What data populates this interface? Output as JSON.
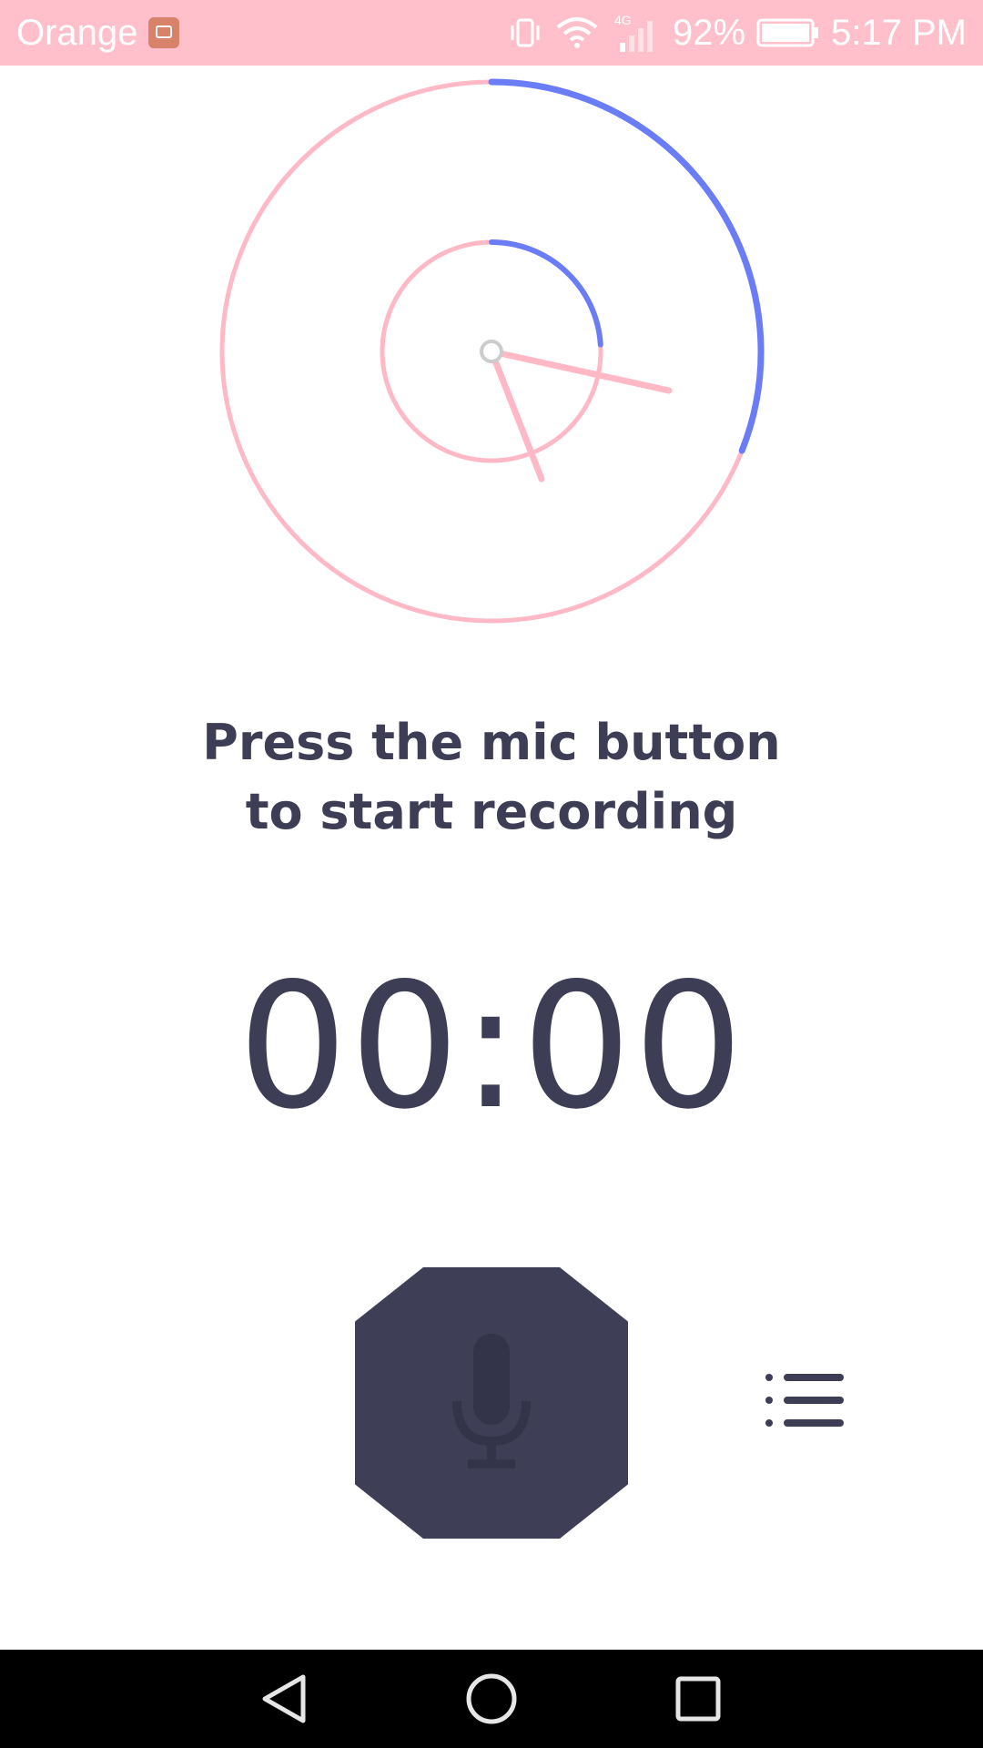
{
  "status_bar": {
    "carrier": "Orange",
    "network": "4G",
    "battery": "92%",
    "time": "5:17 PM",
    "icons": [
      "notification-icon",
      "vibrate-icon",
      "wifi-icon",
      "signal-icon",
      "battery-icon"
    ]
  },
  "clock": {
    "outer_progress_fraction": 0.31,
    "inner_progress_fraction": 0.24,
    "colors": {
      "track": "#ffb8c6",
      "progress": "#6b7cf7",
      "center": "#cccccc"
    }
  },
  "prompt": {
    "line1": "Press the mic button",
    "line2": "to start recording"
  },
  "timer": {
    "value": "00:00"
  },
  "controls": {
    "mic_icon": "microphone-icon",
    "list_icon": "list-icon"
  },
  "nav_bar": {
    "icons": [
      "back-icon",
      "home-icon",
      "recents-icon"
    ]
  },
  "colors": {
    "status_bar": "#ffc0cb",
    "text_dark": "#3d3d55",
    "button": "#3e3f56"
  }
}
